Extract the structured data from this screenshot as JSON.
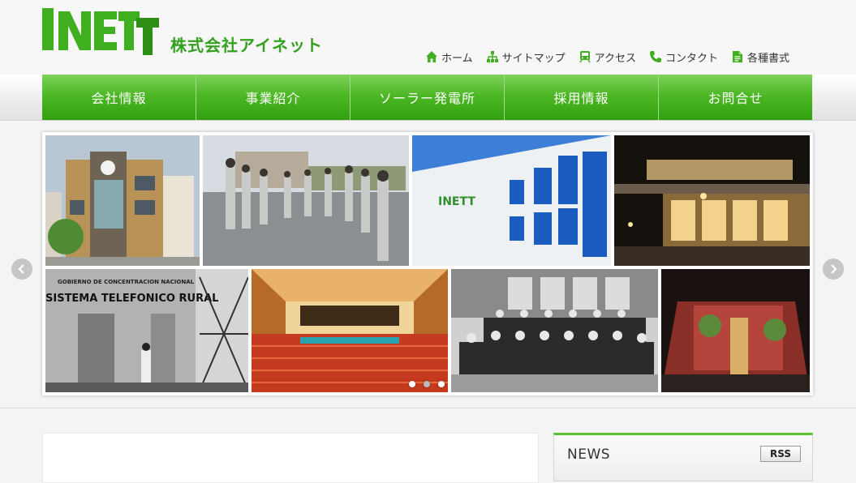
{
  "brand": {
    "logo_word": "INETT",
    "company_name": "株式会社アイネット",
    "green": "#4db825"
  },
  "topnav": [
    {
      "label": "ホーム",
      "icon": "home-icon"
    },
    {
      "label": "サイトマップ",
      "icon": "sitemap-icon"
    },
    {
      "label": "アクセス",
      "icon": "train-icon"
    },
    {
      "label": "コンタクト",
      "icon": "phone-icon"
    },
    {
      "label": "各種書式",
      "icon": "document-icon"
    }
  ],
  "mainnav": [
    {
      "label": "会社情報"
    },
    {
      "label": "事業紹介"
    },
    {
      "label": "ソーラー発電所"
    },
    {
      "label": "採用情報"
    },
    {
      "label": "お問合せ"
    }
  ],
  "slider": {
    "photos": [
      {
        "name": "office-building-photo",
        "sign": ""
      },
      {
        "name": "staff-assembly-photo",
        "sign": ""
      },
      {
        "name": "inett-building-photo",
        "sign": "INETT"
      },
      {
        "name": "night-shopfront-photo",
        "sign": ""
      },
      {
        "name": "rural-telephone-station-photo",
        "sign": "GOBIERNO DE CONCENTRACION NACIONAL",
        "sign2": "SISTEMA TELEFONICO RURAL"
      },
      {
        "name": "concert-hall-photo",
        "sign": ""
      },
      {
        "name": "group-portrait-photo",
        "sign": ""
      },
      {
        "name": "red-gallery-photo",
        "sign": ""
      }
    ],
    "dot_count": 3,
    "active_dot": 1
  },
  "news": {
    "title": "NEWS",
    "rss_label": "RSS"
  }
}
